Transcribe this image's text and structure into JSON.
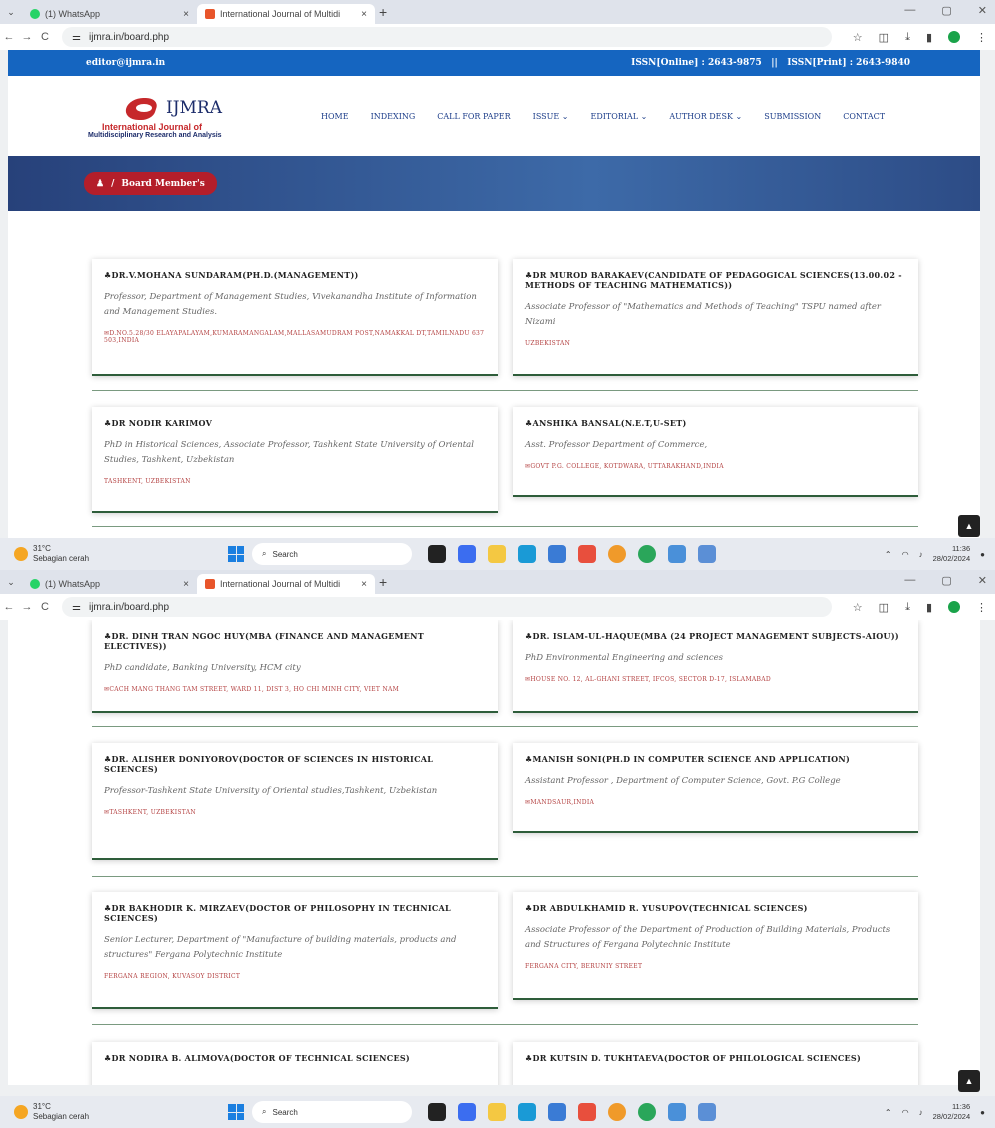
{
  "browser": {
    "tab_inactive_label": "(1) WhatsApp",
    "tab_active_label": "International Journal of Multidi",
    "tab_close": "×",
    "new_tab": "+",
    "url": "ijmra.in/board.php",
    "win_min": "—",
    "win_max": "▢",
    "win_close": "✕"
  },
  "site": {
    "email": "editor@ijmra.in",
    "issn_online": "ISSN[Online] : 2643-9875",
    "issn_sep": "||",
    "issn_print": "ISSN[Print] : 2643-9840",
    "logo_text": "IJMRA",
    "logo_line1": "International Journal of",
    "logo_line2": "Multidisciplinary Research and Analysis",
    "menu": [
      "HOME",
      "INDEXING",
      "CALL FOR PAPER",
      "ISSUE ⌄",
      "EDITORIAL ⌄",
      "AUTHOR DESK ⌄",
      "SUBMISSION",
      "CONTACT"
    ],
    "breadcrumb_sep": "/",
    "breadcrumb": "Board Member's"
  },
  "members_screen1": [
    {
      "name": "♣Dr.V.Mohana Sundaram(Ph.D.(Management))",
      "role": "Professor, Department of Management Studies, Vivekanandha Institute of Information and Management Studies.",
      "loc": "✉D.No.5.28/30 Elayapalayam,Kumaramangalam,Mallasamudram Post,Namakkal Dt,Tamilnadu 637 503,INDIA"
    },
    {
      "name": "♣Dr Murod Barakaev(Candidate of Pedagogical Sciences(13.00.02 - Methods of teaching mathematics))",
      "role": "Associate Professor of \"Mathematics and Methods of Teaching\" TSPU named after Nizami",
      "loc": "Uzbekistan"
    },
    {
      "name": "♣Dr Nodir Karimov",
      "role": "PhD in Historical Sciences, Associate Professor, Tashkent State University of Oriental Studies, Tashkent, Uzbekistan",
      "loc": "Tashkent, Uzbekistan"
    },
    {
      "name": "♣Anshika Bansal(N.E.T,U-SET)",
      "role": "Asst. Professor Department of Commerce,",
      "loc": "✉Govt P.G. College, Kotdwara, Uttarakhand,INDIA"
    }
  ],
  "members_screen2": [
    {
      "name": "♣Dr. Dinh Tran Ngoc Huy(MBA (Finance and Management electives))",
      "role": "PhD candidate, Banking University, HCM city",
      "loc": "✉Cach Mang Thang Tam Street, Ward 11, Dist 3, Ho Chi Minh City, Viet Nam"
    },
    {
      "name": "♣Dr. Islam-ul-Haque(MBA (24 project management subjects-AIOU))",
      "role": "PhD Environmental Engineering and sciences",
      "loc": "✉House No. 12, Al-Ghani Street, IFCOS, Sector D-17, Islamabad"
    },
    {
      "name": "♣Dr. Alisher Doniyorov(Doctor of Sciences in Historical Sciences)",
      "role": "Professor-Tashkent State University of Oriental studies,Tashkent, Uzbekistan",
      "loc": "✉Tashkent, Uzbekistan"
    },
    {
      "name": "♣Manish Soni(Ph.D in Computer Science and Application)",
      "role": "Assistant Professor , Department of Computer Science, Govt. P.G College",
      "loc": "✉Mandsaur,India"
    },
    {
      "name": "♣Dr Bakhodir K. Mirzaev(Doctor of Philosophy in Technical Sciences)",
      "role": "Senior Lecturer, Department of \"Manufacture of building materials, products and structures\" Fergana Polytechnic Institute",
      "loc": "Fergana Region, Kuvasoy District"
    },
    {
      "name": "♣Dr Abdulkhamid R. Yusupov(Technical Sciences)",
      "role": "Associate Professor of the Department of Production of Building Materials, Products and Structures of Fergana Polytechnic Institute",
      "loc": "Fergana City, Beruniy Street"
    },
    {
      "name": "♣Dr Nodira B. Alimova(Doctor of Technical Sciences)",
      "role": "",
      "loc": ""
    },
    {
      "name": "♣Dr Kutsin D. Tukhtaeva(Doctor of Philological Sciences)",
      "role": "",
      "loc": ""
    }
  ],
  "taskbar": {
    "temp": "31°C",
    "weather": "Sebagian cerah",
    "search": "Search",
    "time": "11:36",
    "date": "28/02/2024"
  },
  "colors": {
    "brand_blue": "#1565c0",
    "brand_red": "#c6282b",
    "divider_green": "#2e5d3a"
  }
}
